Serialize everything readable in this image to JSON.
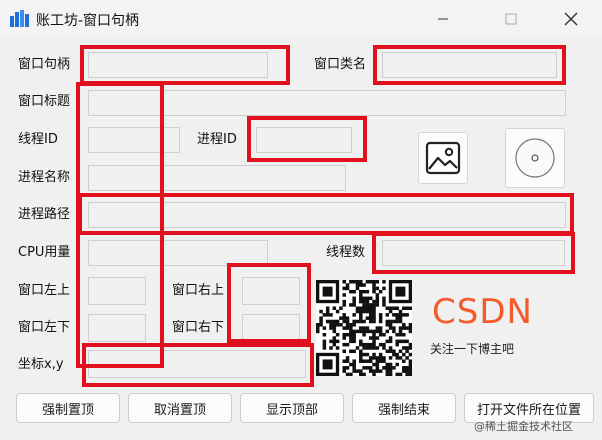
{
  "window": {
    "title": "账工坊-窗口句柄",
    "min_symbol": "—",
    "max_symbol": "☐",
    "close_symbol": "✕"
  },
  "labels": {
    "window_handle": "窗口句柄",
    "window_class": "窗口类名",
    "window_title": "窗口标题",
    "thread_id": "线程ID",
    "process_id": "进程ID",
    "process_name": "进程名称",
    "process_path": "进程路径",
    "cpu_usage": "CPU用量",
    "thread_count": "线程数",
    "top_left": "窗口左上",
    "top_right": "窗口右上",
    "bottom_left": "窗口左下",
    "bottom_right": "窗口右下",
    "coords": "坐标x,y"
  },
  "fields": {
    "window_handle": "",
    "window_class": "",
    "window_title": "",
    "thread_id": "",
    "process_id": "",
    "process_name": "",
    "process_path": "",
    "cpu_usage": "",
    "thread_count": "",
    "top_left": "",
    "top_right": "",
    "bottom_left": "",
    "bottom_right": "",
    "coords": ""
  },
  "buttons": {
    "force_top": "强制置顶",
    "cancel_top": "取消置顶",
    "show_top": "显示顶部",
    "force_close": "强制结束",
    "open_file_location": "打开文件所在位置"
  },
  "branding": {
    "csdn_logo": "CSDN",
    "csdn_tagline": "关注一下博主吧",
    "watermark": "@稀土掘金技术社区"
  },
  "colors": {
    "highlight_red": "#e0101e",
    "csdn_orange": "#f45b2c",
    "background": "#f0f0f0"
  },
  "icons": {
    "app": "app-logo-icon",
    "image_placeholder": "image-icon",
    "disc_placeholder": "disc-icon",
    "qr": "qr-code"
  }
}
